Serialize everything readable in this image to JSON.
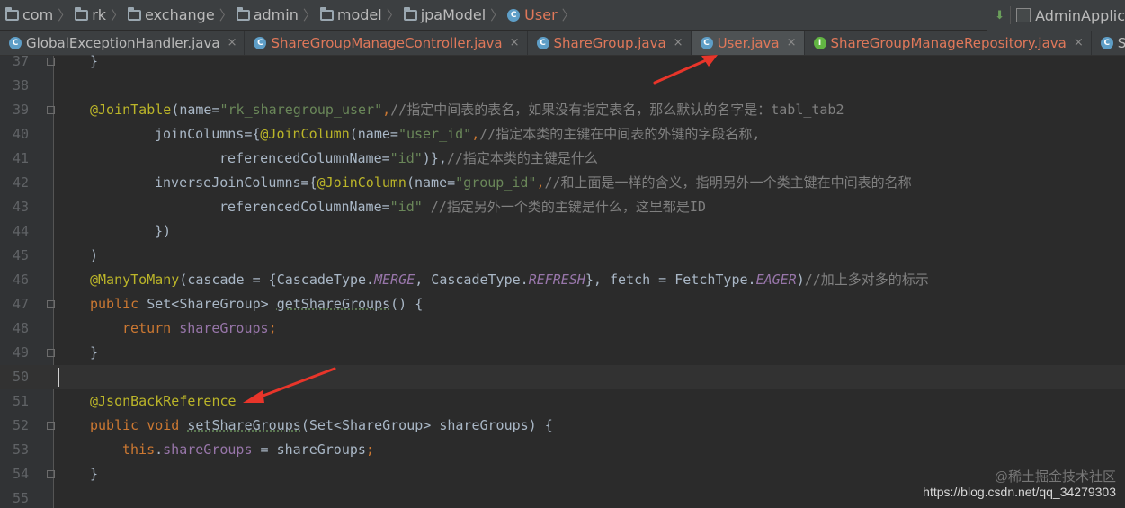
{
  "breadcrumb": {
    "items": [
      {
        "label": "com"
      },
      {
        "label": "rk"
      },
      {
        "label": "exchange"
      },
      {
        "label": "admin"
      },
      {
        "label": "model"
      },
      {
        "label": "jpaModel"
      }
    ],
    "current": {
      "icon": "C",
      "label": "User"
    }
  },
  "toolbar": {
    "run_config": "AdminApplic"
  },
  "tabs": [
    {
      "label": "GlobalExceptionHandler.java",
      "icon": "class-icon"
    },
    {
      "label": "ShareGroupManageController.java",
      "icon": "class-icon"
    },
    {
      "label": "ShareGroup.java",
      "icon": "class-icon"
    },
    {
      "label": "User.java",
      "icon": "class-icon",
      "active": true
    },
    {
      "label": "ShareGroupManageRepository.java",
      "icon": "interface-icon"
    },
    {
      "label": "Sy",
      "icon": "class-icon"
    }
  ],
  "editor": {
    "line_numbers": [
      "37",
      "38",
      "39",
      "40",
      "41",
      "42",
      "43",
      "44",
      "45",
      "46",
      "47",
      "48",
      "49",
      "50",
      "51",
      "52",
      "53",
      "54",
      "55"
    ],
    "caret_line": "50",
    "code": {
      "l37_brace": "}",
      "l39_ann": "@JoinTable",
      "l39_open": "(name=",
      "l39_str": "\"rk_sharegroup_user\"",
      "l39_comma": ",",
      "l39_cmt": "//指定中间表的表名，如果没有指定表名，那么默认的名字是：tabl_tab2",
      "l40_p1": "joinColumns={",
      "l40_ann": "@JoinColumn",
      "l40_p2": "(name=",
      "l40_str": "\"user_id\"",
      "l40_comma": ",",
      "l40_cmt": "//指定本类的主键在中间表的外键的字段名称,",
      "l41_p1": "referencedColumnName=",
      "l41_str": "\"id\"",
      "l41_p2": ")},",
      "l41_cmt": "//指定本类的主键是什么",
      "l42_p1": "inverseJoinColumns={",
      "l42_ann": "@JoinColumn",
      "l42_p2": "(name=",
      "l42_str": "\"group_id\"",
      "l42_comma": ",",
      "l42_cmt": "//和上面是一样的含义，指明另外一个类主键在中间表的名称",
      "l43_p1": "referencedColumnName=",
      "l43_str": "\"id\"",
      "l43_cmt": " //指定另外一个类的主键是什么，这里都是ID",
      "l44": "})",
      "l45": ")",
      "l46_ann": "@ManyToMany",
      "l46_p1": "(cascade = {CascadeType.",
      "l46_e1": "MERGE",
      "l46_p2": ", CascadeType.",
      "l46_e2": "REFRESH",
      "l46_p3": "}, fetch = FetchType.",
      "l46_e3": "EAGER",
      "l46_p4": ")",
      "l46_cmt": "//加上多对多的标示",
      "l47_kw": "public",
      "l47_p1": " Set<ShareGroup> ",
      "l47_m": "getShareGroups",
      "l47_p2": "() {",
      "l48_kw": "return",
      "l48_f": " shareGroups",
      "l48_semi": ";",
      "l49": "}",
      "l51_ann": "@JsonBackReference",
      "l52_kw": "public void",
      "l52_p0": " ",
      "l52_m": "setShareGroups",
      "l52_p1": "(Set<ShareGroup> shareGroups) {",
      "l53_kw": "this",
      "l53_dot": ".",
      "l53_f": "shareGroups",
      "l53_p1": " = shareGroups",
      "l53_semi": ";",
      "l54": "}"
    }
  },
  "watermark": {
    "line1": "@稀土掘金技术社区",
    "line2": "https://blog.csdn.net/qq_34279303"
  },
  "colors": {
    "accent_active_tab": "#e0785a",
    "annotation": "#bbb529",
    "keyword": "#cc7832",
    "string": "#6a8759",
    "comment": "#808080",
    "field": "#9876aa",
    "arrow": "#e8352a"
  }
}
